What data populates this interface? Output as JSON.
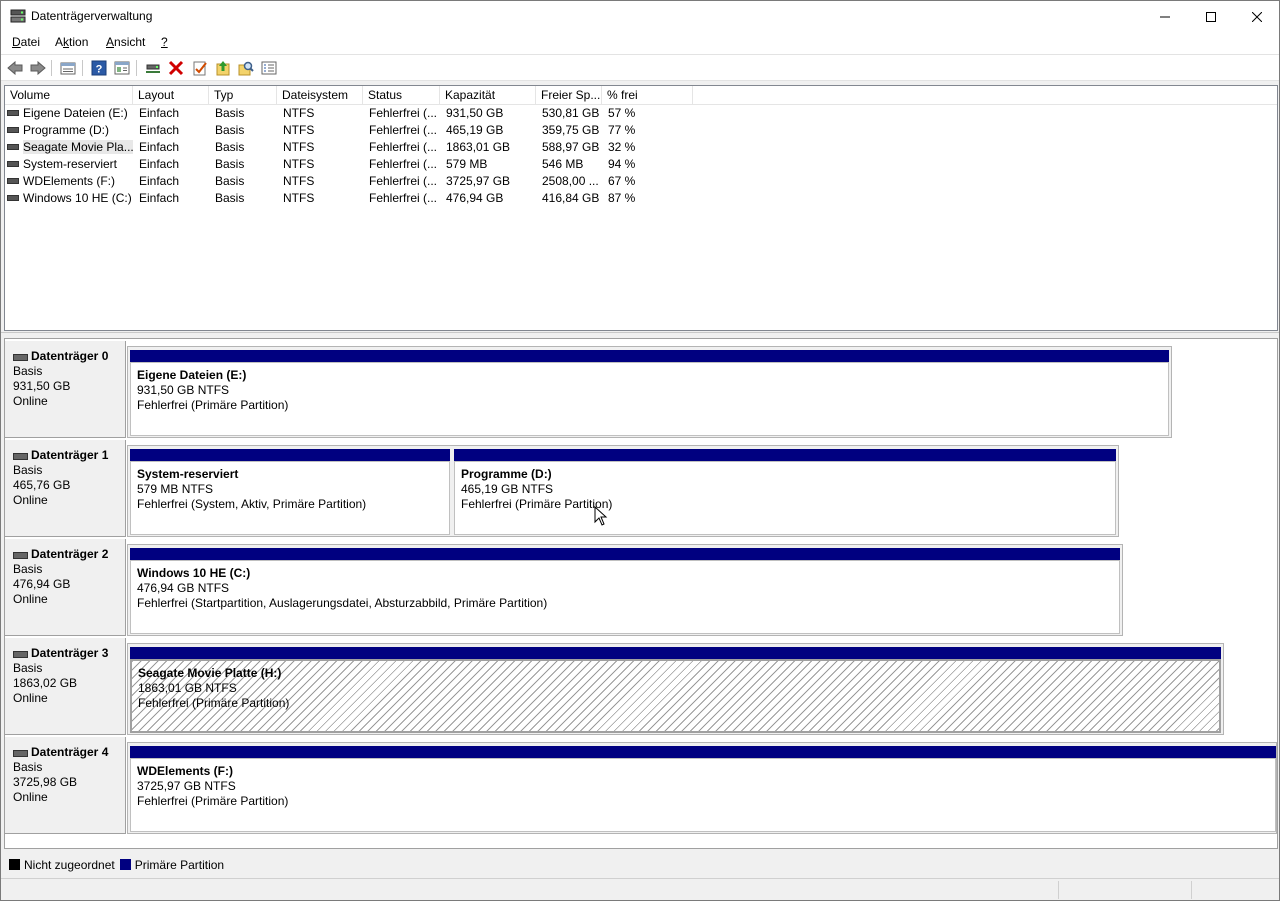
{
  "window": {
    "title": "Datenträgerverwaltung"
  },
  "menu": [
    {
      "label": "Datei"
    },
    {
      "label": "Aktion"
    },
    {
      "label": "Ansicht"
    },
    {
      "label": "?"
    }
  ],
  "toolbar": {
    "icons": [
      "back-icon",
      "forward-icon",
      "disk-list-icon",
      "help-icon",
      "properties-view-icon",
      "connect-icon",
      "delete-icon",
      "check-icon",
      "up-folder-icon",
      "search-folder-icon",
      "console-icon"
    ]
  },
  "volume_list": {
    "columns": [
      "Volume",
      "Layout",
      "Typ",
      "Dateisystem",
      "Status",
      "Kapazität",
      "Freier Sp...",
      "% frei"
    ],
    "rows": [
      {
        "name": "Eigene Dateien (E:)",
        "layout": "Einfach",
        "type": "Basis",
        "fs": "NTFS",
        "status": "Fehlerfrei (...",
        "capacity": "931,50 GB",
        "free": "530,81 GB",
        "pct": "57 %"
      },
      {
        "name": "Programme (D:)",
        "layout": "Einfach",
        "type": "Basis",
        "fs": "NTFS",
        "status": "Fehlerfrei (...",
        "capacity": "465,19 GB",
        "free": "359,75 GB",
        "pct": "77 %"
      },
      {
        "name": "Seagate Movie Pla...",
        "layout": "Einfach",
        "type": "Basis",
        "fs": "NTFS",
        "status": "Fehlerfrei (...",
        "capacity": "1863,01 GB",
        "free": "588,97 GB",
        "pct": "32 %"
      },
      {
        "name": "System-reserviert",
        "layout": "Einfach",
        "type": "Basis",
        "fs": "NTFS",
        "status": "Fehlerfrei (...",
        "capacity": "579 MB",
        "free": "546 MB",
        "pct": "94 %"
      },
      {
        "name": "WDElements (F:)",
        "layout": "Einfach",
        "type": "Basis",
        "fs": "NTFS",
        "status": "Fehlerfrei (...",
        "capacity": "3725,97 GB",
        "free": "2508,00 ...",
        "pct": "67 %"
      },
      {
        "name": "Windows 10 HE (C:)",
        "layout": "Einfach",
        "type": "Basis",
        "fs": "NTFS",
        "status": "Fehlerfrei (...",
        "capacity": "476,94 GB",
        "free": "416,84 GB",
        "pct": "87 %"
      }
    ]
  },
  "disks": [
    {
      "name": "Datenträger 0",
      "type": "Basis",
      "size": "931,50 GB",
      "state": "Online",
      "partitions": [
        {
          "title": "Eigene Dateien  (E:)",
          "size": "931,50 GB NTFS",
          "status": "Fehlerfrei (Primäre Partition)"
        }
      ]
    },
    {
      "name": "Datenträger 1",
      "type": "Basis",
      "size": "465,76 GB",
      "state": "Online",
      "partitions": [
        {
          "title": "System-reserviert",
          "size": "579 MB NTFS",
          "status": "Fehlerfrei (System, Aktiv, Primäre Partition)"
        },
        {
          "title": "Programme  (D:)",
          "size": "465,19 GB NTFS",
          "status": "Fehlerfrei (Primäre Partition)"
        }
      ]
    },
    {
      "name": "Datenträger 2",
      "type": "Basis",
      "size": "476,94 GB",
      "state": "Online",
      "partitions": [
        {
          "title": "Windows 10 HE  (C:)",
          "size": "476,94 GB NTFS",
          "status": "Fehlerfrei (Startpartition, Auslagerungsdatei, Absturzabbild, Primäre Partition)"
        }
      ]
    },
    {
      "name": "Datenträger 3",
      "type": "Basis",
      "size": "1863,02 GB",
      "state": "Online",
      "partitions": [
        {
          "title": "Seagate Movie Platte  (H:)",
          "size": "1863,01 GB NTFS",
          "status": "Fehlerfrei (Primäre Partition)",
          "selected": true
        }
      ]
    },
    {
      "name": "Datenträger 4",
      "type": "Basis",
      "size": "3725,98 GB",
      "state": "Online",
      "partitions": [
        {
          "title": "WDElements  (F:)",
          "size": "3725,97 GB NTFS",
          "status": "Fehlerfrei (Primäre Partition)"
        }
      ]
    }
  ],
  "legend": {
    "unallocated": {
      "label": "Nicht zugeordnet",
      "color": "#000000"
    },
    "primary": {
      "label": "Primäre Partition",
      "color": "#000080"
    }
  },
  "colors": {
    "partition_bar": "#000080",
    "delete_icon": "#d00000"
  }
}
